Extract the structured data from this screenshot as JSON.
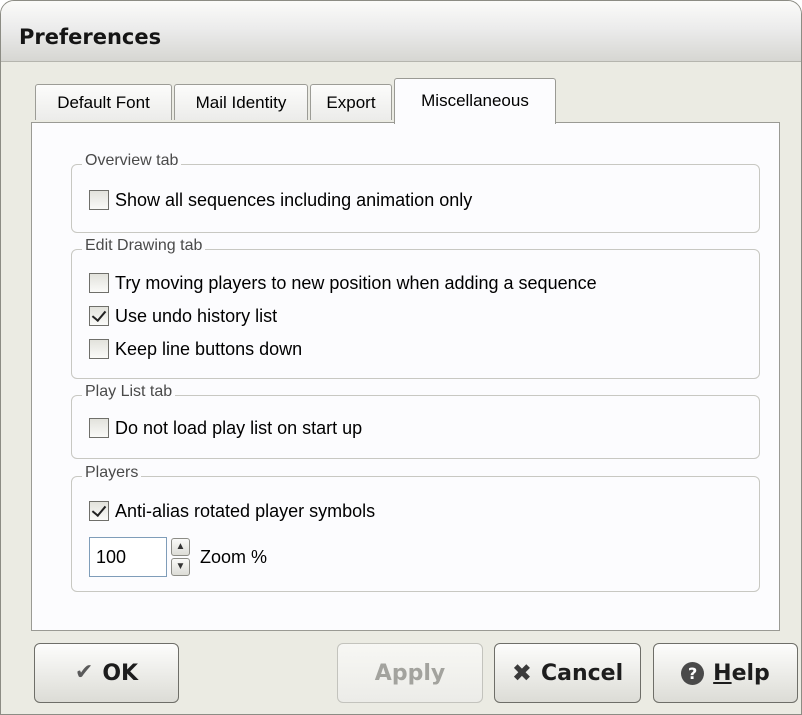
{
  "window": {
    "title": "Preferences"
  },
  "tabs": [
    {
      "label": "Default Font",
      "active": false
    },
    {
      "label": "Mail Identity",
      "active": false
    },
    {
      "label": "Export",
      "active": false
    },
    {
      "label": "Miscellaneous",
      "active": true
    }
  ],
  "groups": {
    "overview": {
      "legend": "Overview tab",
      "options": [
        {
          "label": "Show all sequences including animation only",
          "checked": false
        }
      ]
    },
    "edit_drawing": {
      "legend": "Edit Drawing tab",
      "options": [
        {
          "label": "Try moving players to new position when adding a sequence",
          "checked": false
        },
        {
          "label": "Use undo history list",
          "checked": true
        },
        {
          "label": "Keep line buttons down",
          "checked": false
        }
      ]
    },
    "play_list": {
      "legend": "Play List tab",
      "options": [
        {
          "label": "Do not load play list on start up",
          "checked": false
        }
      ]
    },
    "players": {
      "legend": "Players",
      "options": [
        {
          "label": "Anti-alias rotated player symbols",
          "checked": true
        }
      ],
      "zoom": {
        "value": "100",
        "label": "Zoom %"
      }
    }
  },
  "buttons": {
    "ok": {
      "label": "OK",
      "icon": "checkmark-icon",
      "enabled": true
    },
    "apply": {
      "label": "Apply",
      "enabled": false
    },
    "cancel": {
      "label": "Cancel",
      "icon": "close-x-icon",
      "enabled": true
    },
    "help": {
      "mnemonic": "H",
      "rest": "elp",
      "icon": "question-circle-icon",
      "enabled": true
    }
  }
}
